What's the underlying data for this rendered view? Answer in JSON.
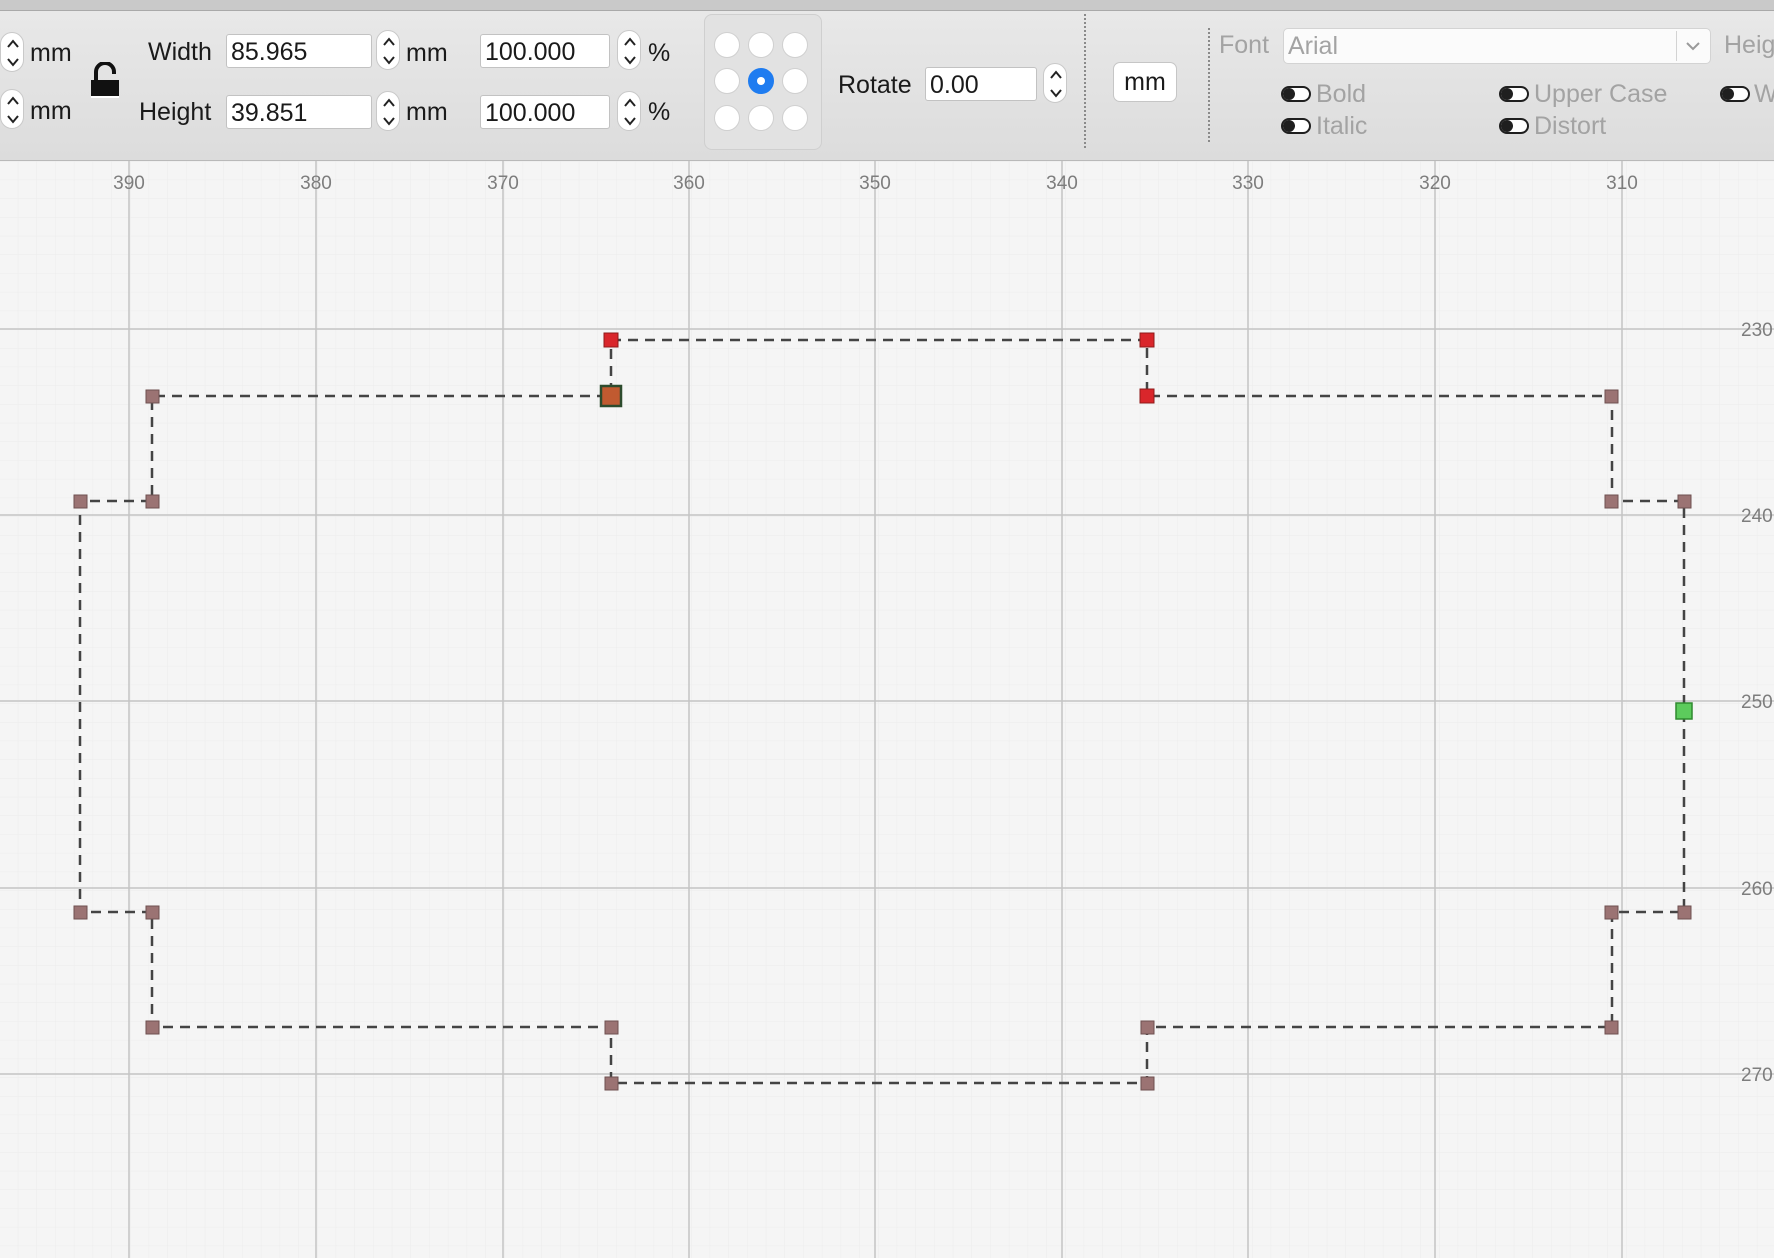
{
  "toolbar": {
    "unit_left": "mm",
    "width_label": "Width",
    "width_value": "85.965",
    "height_label": "Height",
    "height_value": "39.851",
    "mm": "mm",
    "width_pct": "100.000",
    "height_pct": "100.000",
    "pct": "%",
    "rotate_label": "Rotate",
    "rotate_value": "0.00",
    "units_button": "mm",
    "font_label": "Font",
    "font_value": "Arial",
    "height_cut_label": "Heig",
    "bold": "Bold",
    "italic": "Italic",
    "upper_case": "Upper Case",
    "distort": "Distort",
    "welded_cut": "W",
    "anchor_selected": "center"
  },
  "ruler": {
    "x_ticks": [
      "390",
      "380",
      "370",
      "360",
      "350",
      "340",
      "330",
      "320",
      "310"
    ],
    "y_ticks": [
      "230",
      "240",
      "250",
      "260",
      "270"
    ]
  },
  "colors": {
    "accent": "#1f7cf0",
    "node": "#9b7373",
    "node_selected": "#d9262b",
    "node_start": "#5ccb5c",
    "node_current": "#c15a30"
  }
}
